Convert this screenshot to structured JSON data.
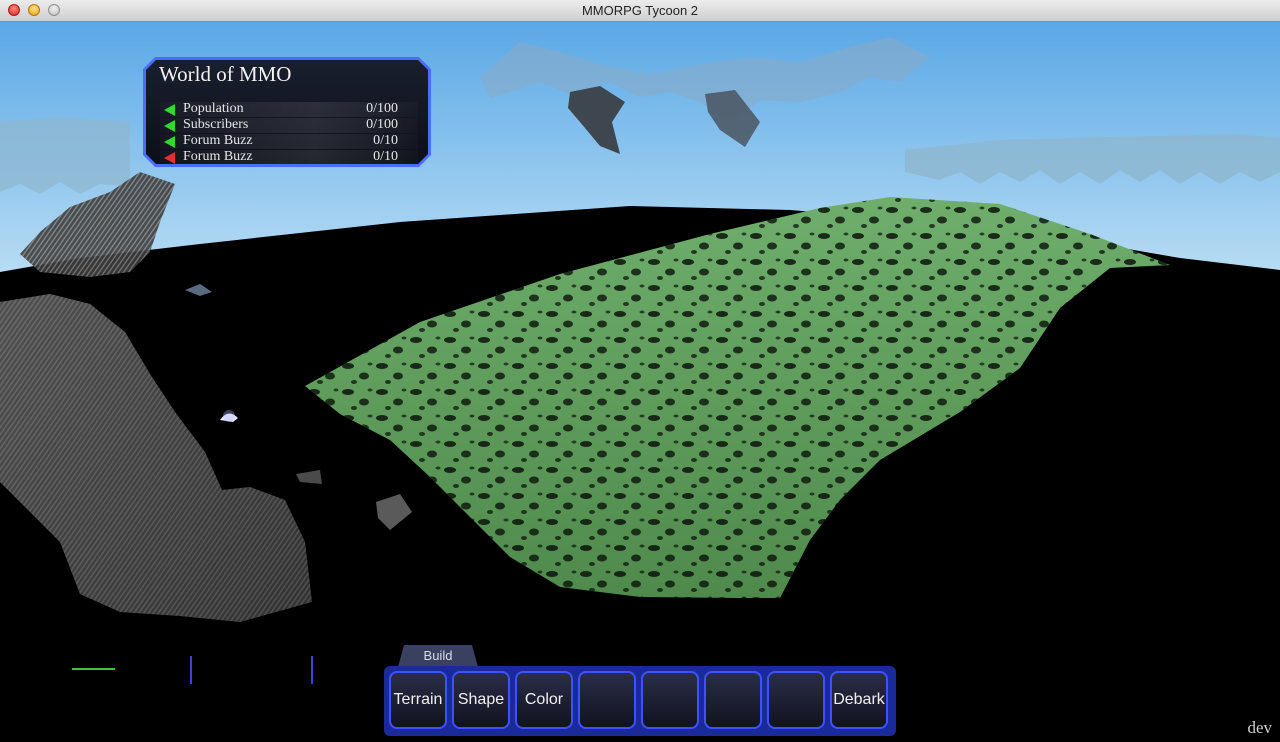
{
  "window": {
    "title": "MMORPG Tycoon 2"
  },
  "stats_panel": {
    "title": "World of MMO",
    "rows": [
      {
        "label": "Population",
        "value": "0/100",
        "trend": "up"
      },
      {
        "label": "Subscribers",
        "value": "0/100",
        "trend": "up"
      },
      {
        "label": "Forum Buzz",
        "value": "0/10",
        "trend": "up"
      },
      {
        "label": "Forum Buzz",
        "value": "0/10",
        "trend": "down"
      }
    ]
  },
  "toolbar": {
    "tab_label": "Build",
    "slots": [
      "Terrain",
      "Shape",
      "Color",
      "",
      "",
      "",
      "",
      "Debark"
    ]
  },
  "build_tag": "dev",
  "colors": {
    "sky_top": "#5aa8e6",
    "sky_bottom": "#c6e4f6",
    "terrain": "#5a9a58",
    "accent": "#3d52ff"
  }
}
